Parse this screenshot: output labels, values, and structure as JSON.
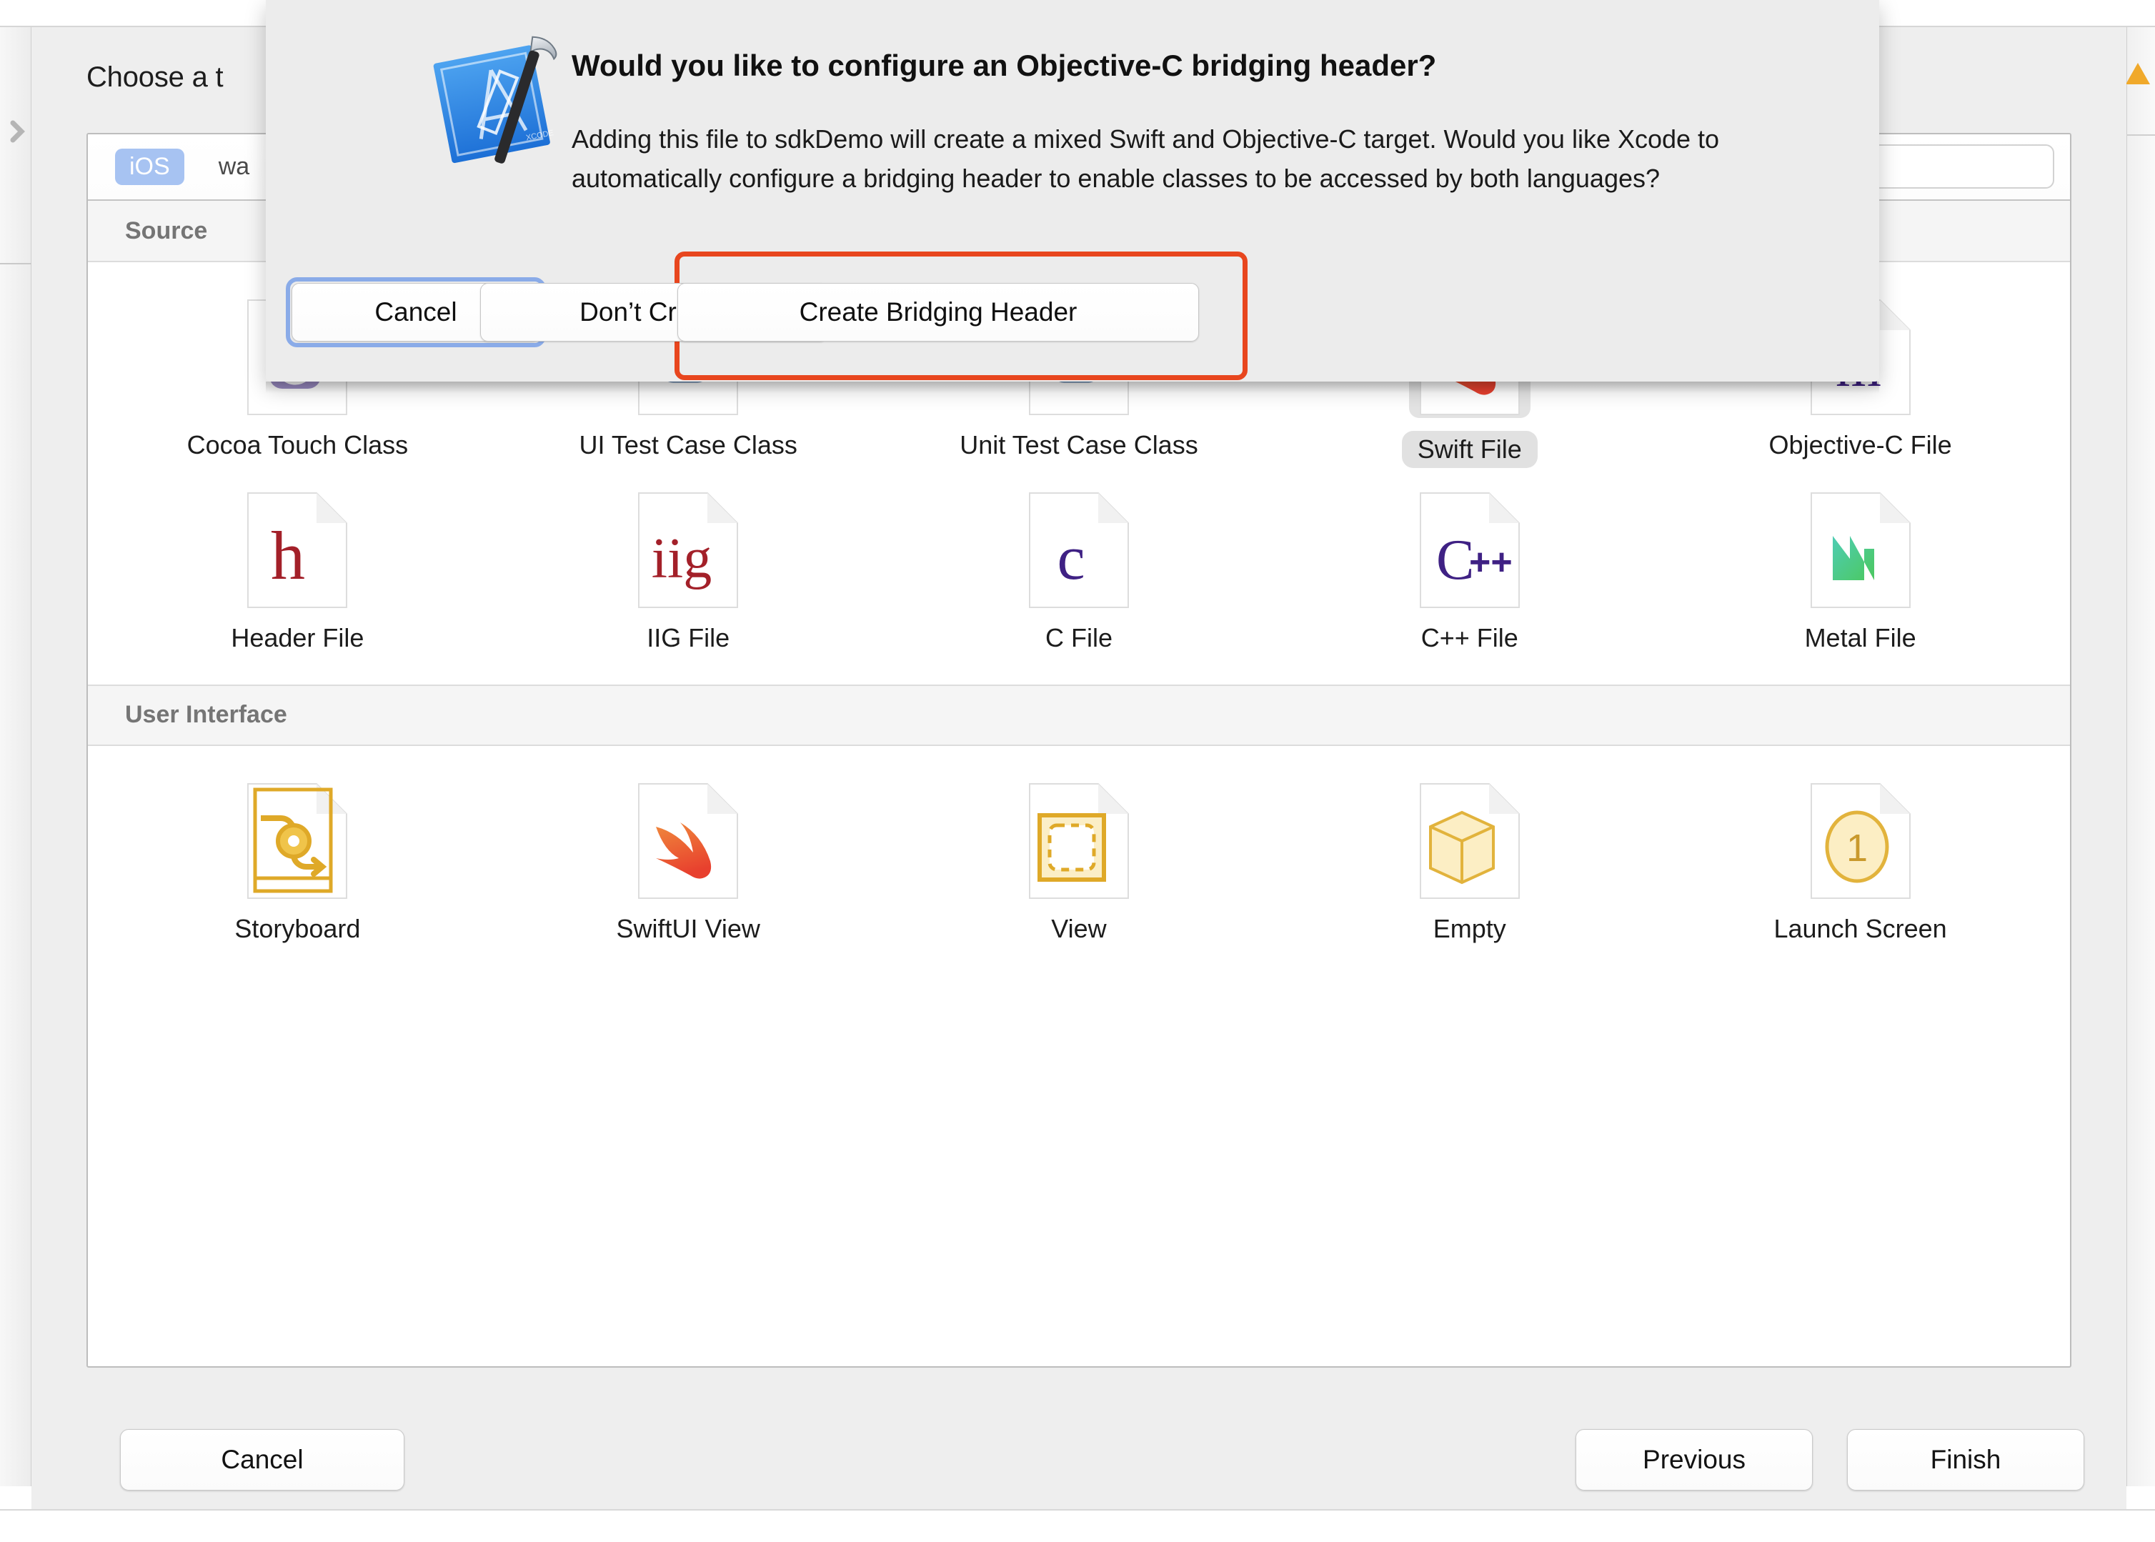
{
  "window": {
    "sheet_title": "Choose a template for your new file:",
    "sheet_title_visible": "Choose a t",
    "warning_icon": "warning-triangle-icon",
    "rail_chevron_icon": "chevron-right-icon"
  },
  "platform_tabs": {
    "items": [
      {
        "label": "iOS",
        "selected": true
      },
      {
        "label": "watchOS",
        "visible_text": "wa",
        "selected": false
      }
    ]
  },
  "search": {
    "value": "",
    "placeholder": ""
  },
  "sections": [
    {
      "header": "Source",
      "header_visible": "Source",
      "items": [
        {
          "label": "Cocoa Touch Class",
          "icon": "cocoa-touch-class-icon",
          "selected": false
        },
        {
          "label": "UI Test Case Class",
          "icon": "ui-test-case-class-icon",
          "selected": false
        },
        {
          "label": "Unit Test Case Class",
          "icon": "unit-test-case-class-icon",
          "selected": false
        },
        {
          "label": "Swift File",
          "icon": "swift-file-icon",
          "selected": true
        },
        {
          "label": "Objective-C File",
          "icon": "objective-c-file-icon",
          "selected": false
        },
        {
          "label": "Header File",
          "icon": "header-file-icon",
          "selected": false
        },
        {
          "label": "IIG File",
          "icon": "iig-file-icon",
          "selected": false
        },
        {
          "label": "C File",
          "icon": "c-file-icon",
          "selected": false
        },
        {
          "label": "C++ File",
          "icon": "cpp-file-icon",
          "selected": false
        },
        {
          "label": "Metal File",
          "icon": "metal-file-icon",
          "selected": false
        }
      ]
    },
    {
      "header": "User Interface",
      "items": [
        {
          "label": "Storyboard",
          "icon": "storyboard-icon",
          "selected": false
        },
        {
          "label": "SwiftUI View",
          "icon": "swiftui-view-icon",
          "selected": false
        },
        {
          "label": "View",
          "icon": "view-icon",
          "selected": false
        },
        {
          "label": "Empty",
          "icon": "empty-file-icon",
          "selected": false
        },
        {
          "label": "Launch Screen",
          "icon": "launch-screen-icon",
          "selected": false
        }
      ]
    }
  ],
  "footer": {
    "cancel_label": "Cancel",
    "previous_label": "Previous",
    "finish_label": "Finish"
  },
  "alert": {
    "icon": "xcode-app-icon",
    "title": "Would you like to configure an Objective-C bridging header?",
    "body": "Adding this file to sdkDemo will create a mixed Swift and Objective-C target. Would you like Xcode to automatically configure a bridging header to enable classes to be accessed by both languages?",
    "buttons": {
      "cancel_label": "Cancel",
      "dont_create_label": "Don’t Create",
      "create_bridging_header_label": "Create Bridging Header"
    },
    "highlight_color": "#e8461e",
    "focus_ring_color": "#8aabe8"
  }
}
